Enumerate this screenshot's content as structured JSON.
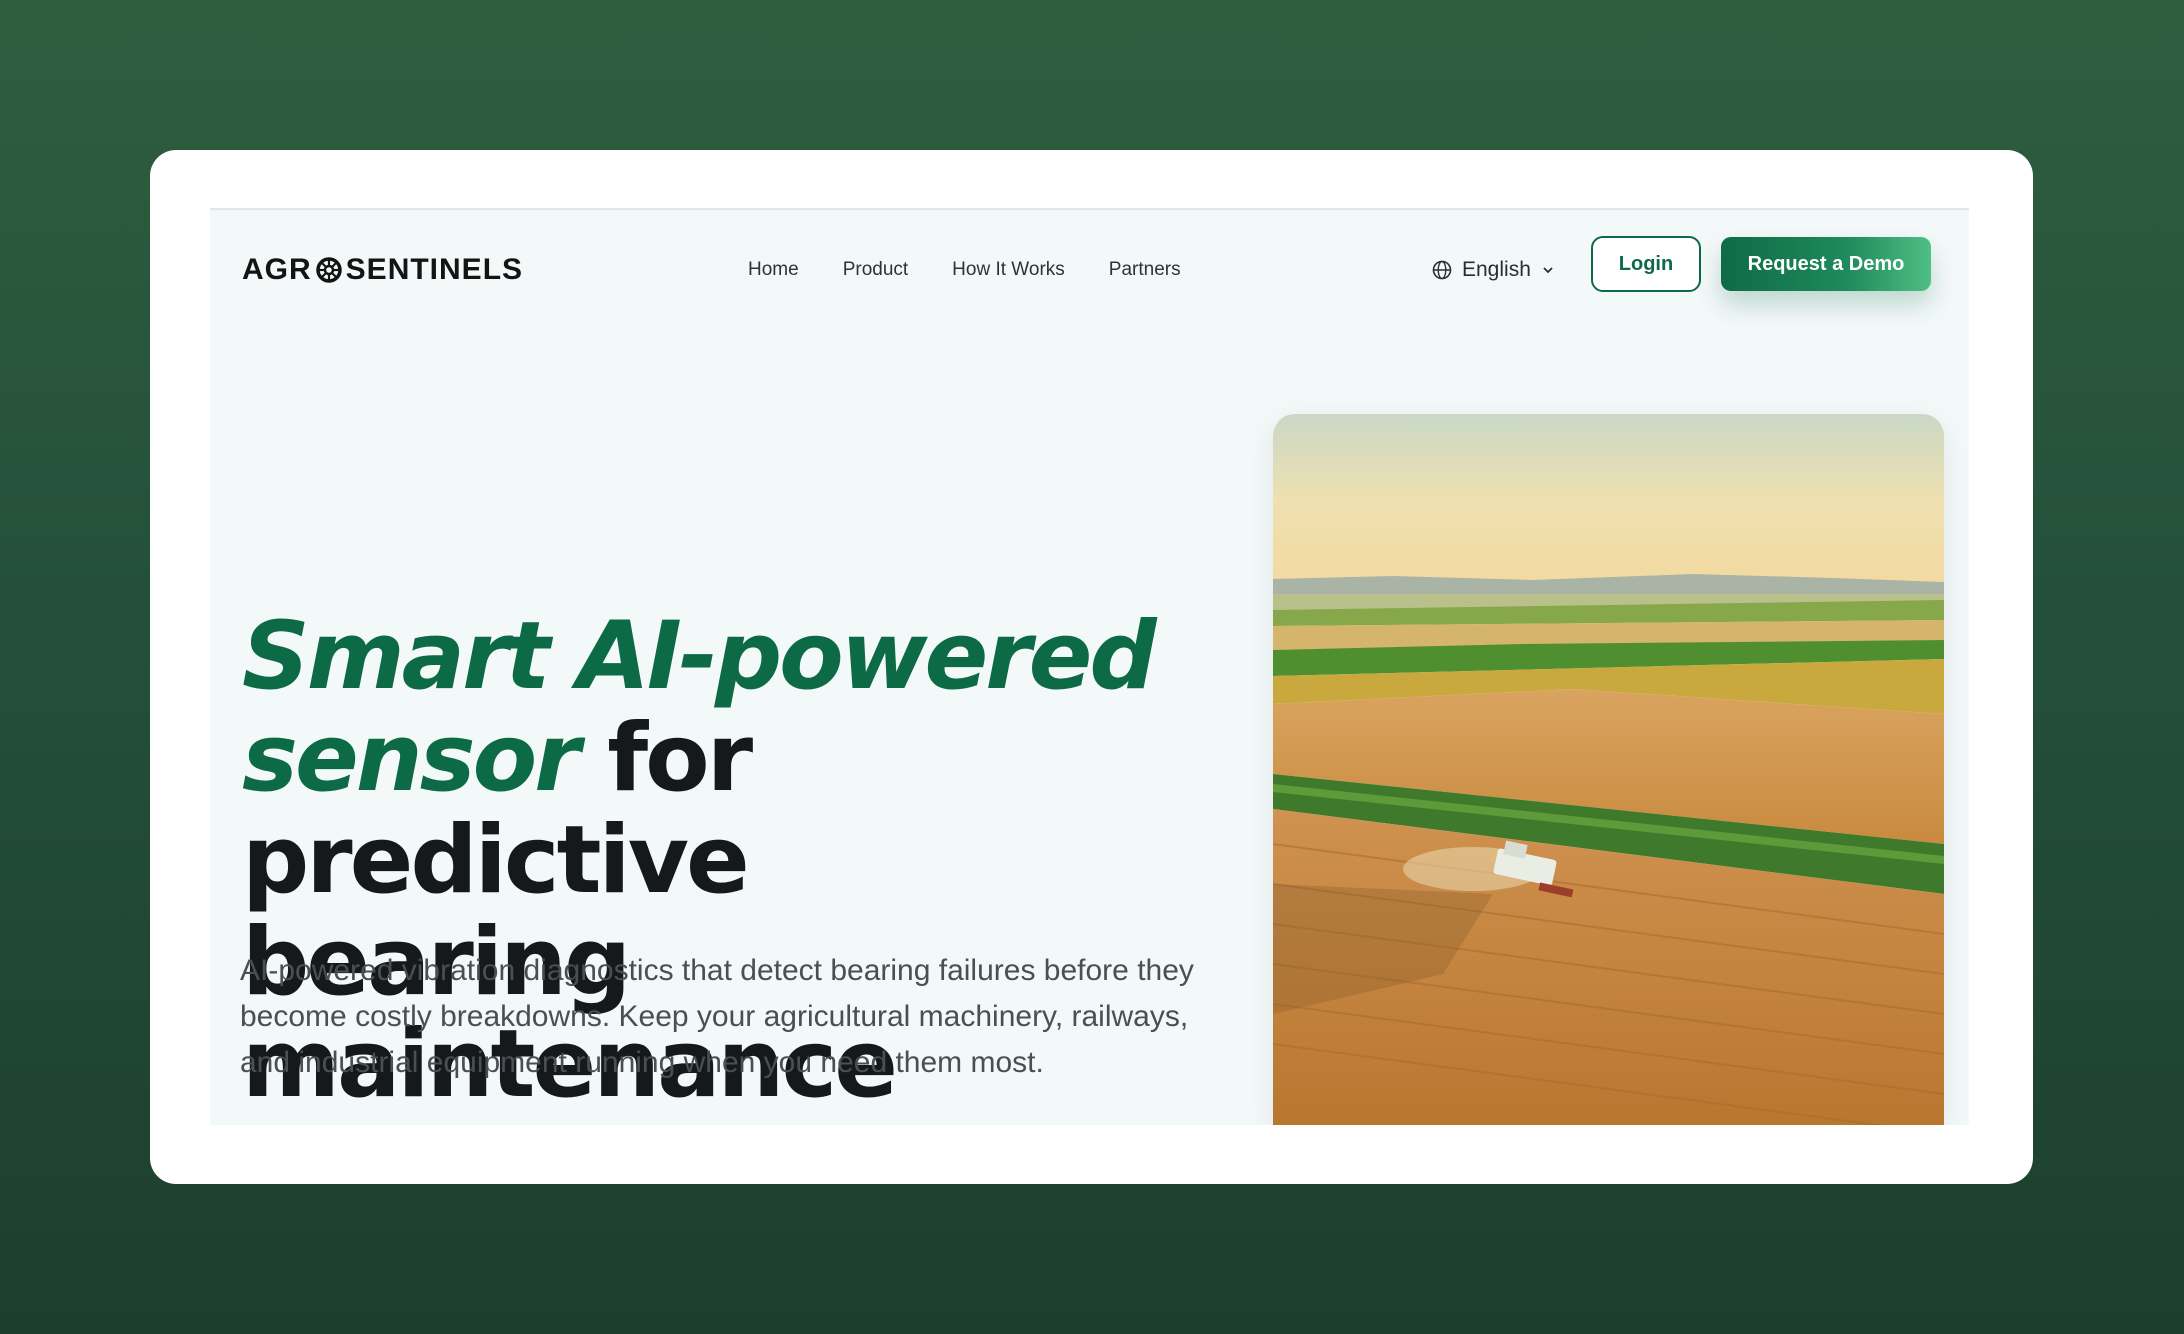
{
  "brand": {
    "name_left": "AGR",
    "name_right": "SENTINELS"
  },
  "nav": {
    "items": [
      "Home",
      "Product",
      "How It Works",
      "Partners"
    ]
  },
  "language": {
    "selected": "English"
  },
  "actions": {
    "login": "Login",
    "demo": "Request a Demo"
  },
  "hero": {
    "headline_accent": "Smart AI-powered sensor",
    "headline_rest_1": "for predictive",
    "headline_rest_2": "bearing maintenance",
    "description": "AI-powered vibration diagnostics that detect bearing failures before they become costly breakdowns. Keep your agricultural machinery, railways, and industrial equipment running when you need them most.",
    "image_subject": "aerial view of combine harvester in wheat field"
  },
  "colors": {
    "brand_green": "#0d6a47",
    "background": "#24503a",
    "text": "#16191c"
  }
}
